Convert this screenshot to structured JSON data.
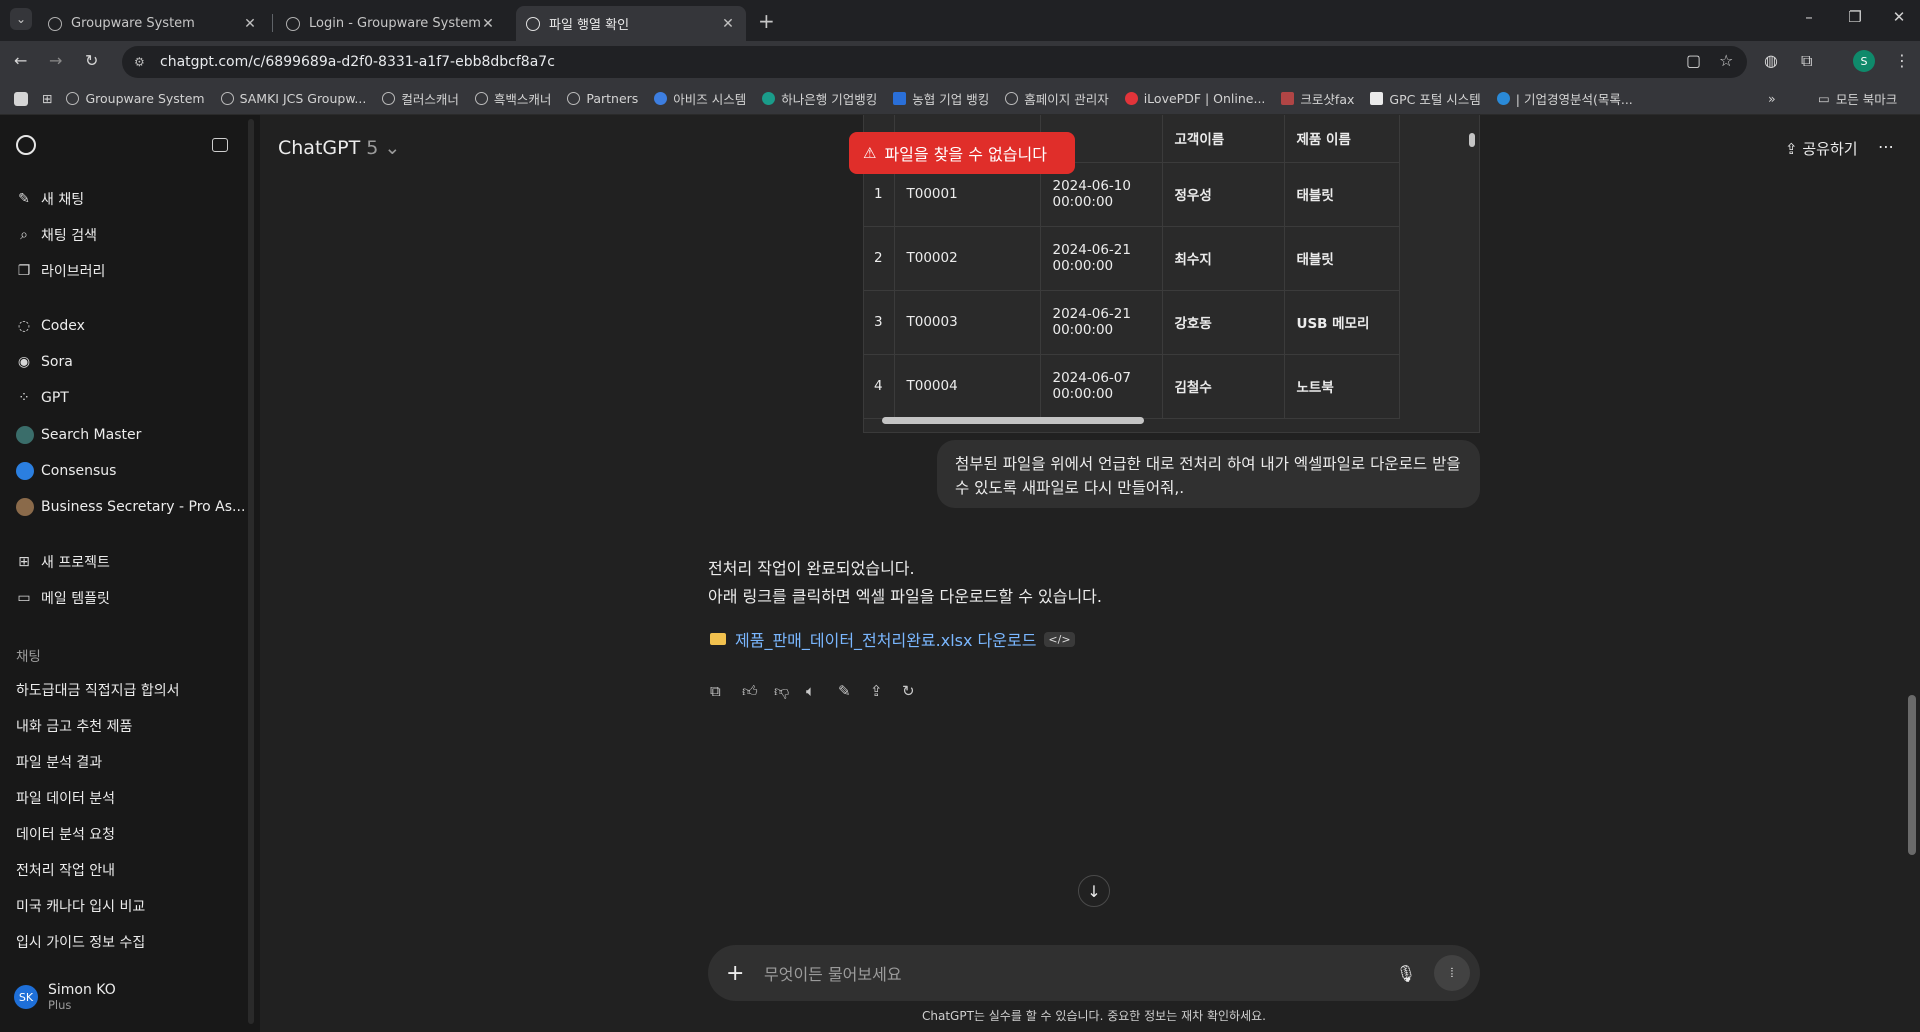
{
  "browser": {
    "tabs": [
      {
        "title": "Groupware System",
        "active": false
      },
      {
        "title": "Login - Groupware System",
        "active": false
      },
      {
        "title": "파일 행열 확인",
        "active": true
      }
    ],
    "url": "chatgpt.com/c/6899689a-d2f0-8331-a1f7-ebb8dbcf8a7c",
    "profile_initial": "S"
  },
  "bookmarks": {
    "items": [
      "Groupware System",
      "SAMKI JCS Groupw...",
      "컬러스캐너",
      "흑백스캐너",
      "Partners",
      "아비즈 시스템",
      "하나은행 기업뱅킹",
      "농협 기업 뱅킹",
      "홈페이지 관리자",
      "iLovePDF | Online...",
      "크로샷fax",
      "GPC 포털 시스템",
      "| 기업경영분석(목록..."
    ],
    "all_bookmarks": "모든 북마크"
  },
  "sidebar": {
    "top_items": [
      "새 채팅",
      "채팅 검색",
      "라이브러리"
    ],
    "apps": [
      "Codex",
      "Sora",
      "GPT",
      "Search Master",
      "Consensus",
      "Business Secretary - Pro As..."
    ],
    "project_items": [
      "새 프로젝트",
      "메일 템플릿"
    ],
    "chats_label": "채팅",
    "chats": [
      "하도급대금 직접지급 합의서",
      "내화 금고 추천 제품",
      "파일 분석 결과",
      "파일 데이터 분석",
      "데이터 분석 요청",
      "전처리 작업 안내",
      "미국 캐나다 입시 비교",
      "입시 가이드 정보 수집"
    ],
    "user": {
      "initials": "SK",
      "name": "Simon KO",
      "plan": "Plus"
    }
  },
  "header": {
    "model": "ChatGPT",
    "version": "5",
    "share_label": "공유하기"
  },
  "toast": {
    "message": "파일을 찾을 수 없습니다"
  },
  "table": {
    "headers": [
      "",
      "",
      "",
      "고객이름",
      "제품 이름"
    ],
    "rows": [
      {
        "num": "1",
        "id": "T00001",
        "date": "2024-06-10",
        "time": "00:00:00",
        "customer": "정우성",
        "product": "태블릿"
      },
      {
        "num": "2",
        "id": "T00002",
        "date": "2024-06-21",
        "time": "00:00:00",
        "customer": "최수지",
        "product": "태블릿"
      },
      {
        "num": "3",
        "id": "T00003",
        "date": "2024-06-21",
        "time": "00:00:00",
        "customer": "강호동",
        "product": "USB 메모리"
      },
      {
        "num": "4",
        "id": "T00004",
        "date": "2024-06-07",
        "time": "00:00:00",
        "customer": "김철수",
        "product": "노트북"
      }
    ]
  },
  "messages": {
    "user_message": "첨부된 파일을 위에서 언급한 대로 전처리 하여 내가 엑셀파일로 다운로드 받을 수 있도록 새파일로 다시 만들어줘,.",
    "assistant_line1": "전처리 작업이 완료되었습니다.",
    "assistant_line2": "아래 링크를 클릭하면 엑셀 파일을 다운로드할 수 있습니다.",
    "download_link": "제품_판매_데이터_전처리완료.xlsx 다운로드"
  },
  "composer": {
    "placeholder": "무엇이든 물어보세요",
    "disclaimer": "ChatGPT는 실수를 할 수 있습니다. 중요한 정보는 재차 확인하세요."
  }
}
